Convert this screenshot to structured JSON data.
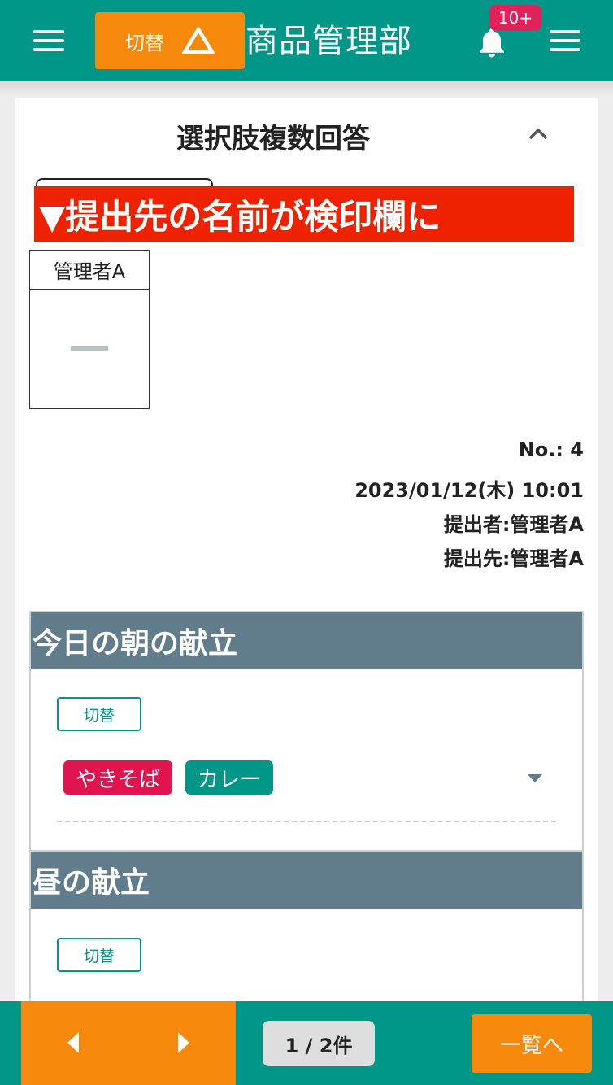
{
  "header": {
    "switch_label": "切替",
    "title": "商品管理部",
    "notification_badge": "10+"
  },
  "card": {
    "title": "選択肢複数回答",
    "annotation": "▼提出先の名前が検印欄に",
    "stamp": {
      "name": "管理者A"
    },
    "meta": {
      "number": "No.: 4",
      "datetime": "2023/01/12(木) 10:01",
      "submitter": "提出者:管理者A",
      "recipient": "提出先:管理者A"
    }
  },
  "sections": [
    {
      "title": "今日の朝の献立",
      "switch_label": "切替",
      "tags": [
        {
          "label": "やきそば",
          "color": "#e0154f"
        },
        {
          "label": "カレー",
          "color": "#009688"
        }
      ]
    },
    {
      "title": "昼の献立",
      "switch_label": "切替"
    }
  ],
  "footer": {
    "page_count": "1 / 2件",
    "list_label": "一覧へ"
  },
  "colors": {
    "primary": "#009688",
    "accent": "#f6880c",
    "badge": "#e0215a",
    "section_header": "#617d8b",
    "annotation": "#ee2200"
  }
}
